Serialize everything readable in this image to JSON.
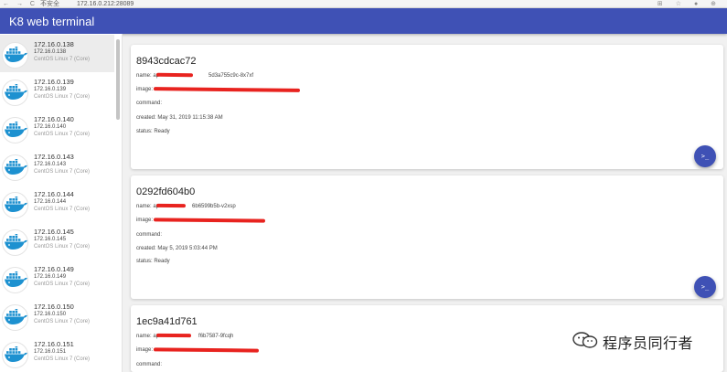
{
  "browser": {
    "nav_icons": "← → C ⌂",
    "security_label": "不安全",
    "url": "172.16.0.212:28089",
    "right_icons": "⊞ ☆ ● ⊕"
  },
  "app": {
    "title": "K8 web terminal",
    "accent": "#3f51b5"
  },
  "sidebar": {
    "hosts": [
      {
        "ip": "172.16.0.138",
        "sub_ip": "172.16.0.138",
        "os": "CentOS Linux 7 (Core)"
      },
      {
        "ip": "172.16.0.139",
        "sub_ip": "172.16.0.139",
        "os": "CentOS Linux 7 (Core)"
      },
      {
        "ip": "172.16.0.140",
        "sub_ip": "172.16.0.140",
        "os": "CentOS Linux 7 (Core)"
      },
      {
        "ip": "172.16.0.143",
        "sub_ip": "172.16.0.143",
        "os": "CentOS Linux 7 (Core)"
      },
      {
        "ip": "172.16.0.144",
        "sub_ip": "172.16.0.144",
        "os": "CentOS Linux 7 (Core)"
      },
      {
        "ip": "172.16.0.145",
        "sub_ip": "172.16.0.145",
        "os": "CentOS Linux 7 (Core)"
      },
      {
        "ip": "172.16.0.149",
        "sub_ip": "172.16.0.149",
        "os": "CentOS Linux 7 (Core)"
      },
      {
        "ip": "172.16.0.150",
        "sub_ip": "172.16.0.150",
        "os": "CentOS Linux 7 (Core)"
      },
      {
        "ip": "172.16.0.151",
        "sub_ip": "172.16.0.151",
        "os": "CentOS Linux 7 (Core)"
      }
    ]
  },
  "containers": [
    {
      "id": "8943cdcac72",
      "name_prefix": "name: ap",
      "name_suffix": "5d3a755c9c-8x7xf",
      "image_prefix": "image:",
      "command": "command:",
      "created": "created: May 31, 2019 11:15:38 AM",
      "status": "status: Ready",
      "terminal_label": ">_"
    },
    {
      "id": "0292fd604b0",
      "name_prefix": "name: ap",
      "name_suffix": "6b6599b5b-v2xsp",
      "image_prefix": "image:",
      "command": "command:",
      "created": "created: May 5, 2019 5:03:44 PM",
      "status": "status: Ready",
      "terminal_label": ">_"
    },
    {
      "id": "1ec9a41d761",
      "name_prefix": "name: ap",
      "name_suffix": "f6b7587-9fcqh",
      "image_prefix": "image:",
      "command": "command:",
      "created": "",
      "status": "",
      "terminal_label": ""
    }
  ],
  "watermark": {
    "text": "程序员同行者"
  }
}
